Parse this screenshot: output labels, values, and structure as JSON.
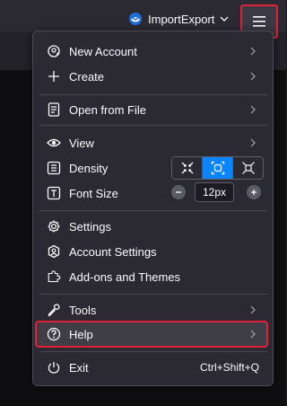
{
  "toolbar": {
    "account_label": "ImportExport"
  },
  "menu": {
    "items": [
      {
        "label": "New Account",
        "icon": "new-account-icon",
        "submenu": true
      },
      {
        "label": "Create",
        "icon": "plus-icon",
        "submenu": true
      },
      {
        "label": "Open from File",
        "icon": "file-icon",
        "submenu": true
      },
      {
        "label": "View",
        "icon": "eye-icon",
        "submenu": true
      },
      {
        "label": "Density",
        "icon": "density-icon"
      },
      {
        "label": "Font Size",
        "icon": "font-size-icon"
      },
      {
        "label": "Settings",
        "icon": "gear-icon"
      },
      {
        "label": "Account Settings",
        "icon": "account-settings-icon"
      },
      {
        "label": "Add-ons and Themes",
        "icon": "puzzle-icon"
      },
      {
        "label": "Tools",
        "icon": "wrench-icon",
        "submenu": true
      },
      {
        "label": "Help",
        "icon": "help-icon",
        "submenu": true
      },
      {
        "label": "Exit",
        "icon": "power-icon",
        "shortcut": "Ctrl+Shift+Q"
      }
    ],
    "density_selected": "default",
    "font_size": "12px"
  },
  "colors": {
    "accent": "#0a84ff",
    "highlight_border": "#e0203a",
    "menu_bg": "#2b2a33"
  }
}
